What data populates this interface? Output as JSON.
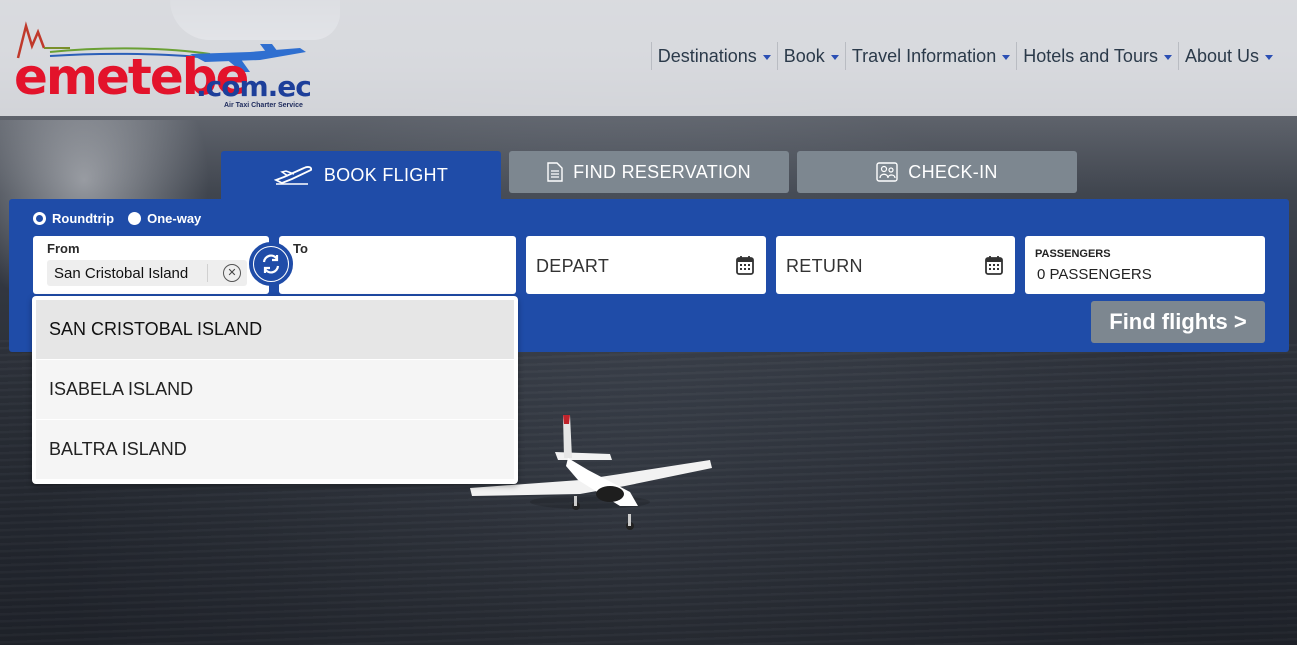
{
  "brand": {
    "logo_text": "emetebe",
    "logo_domain": ".com.ec",
    "logo_tagline": "Air Taxi Charter Service",
    "primary_color": "#1f4ca8",
    "logo_red": "#e3132b"
  },
  "nav": {
    "items": [
      {
        "label": "Destinations"
      },
      {
        "label": "Book"
      },
      {
        "label": "Travel Information"
      },
      {
        "label": "Hotels and Tours"
      },
      {
        "label": "About Us"
      }
    ]
  },
  "tabs": [
    {
      "label": "BOOK FLIGHT",
      "icon": "plane-icon",
      "active": true
    },
    {
      "label": "FIND RESERVATION",
      "icon": "document-icon",
      "active": false
    },
    {
      "label": "CHECK-IN",
      "icon": "passengers-icon",
      "active": false
    }
  ],
  "booking": {
    "trip_types": [
      {
        "label": "Roundtrip",
        "checked": true
      },
      {
        "label": "One-way",
        "checked": false
      }
    ],
    "from": {
      "label": "From",
      "value": "San Cristobal Island"
    },
    "to": {
      "label": "To",
      "value": ""
    },
    "depart": {
      "label": "DEPART"
    },
    "return": {
      "label": "RETURN"
    },
    "passengers": {
      "label": "PASSENGERS",
      "value": "0 PASSENGERS"
    },
    "find_button": "Find flights >"
  },
  "dropdown": {
    "options": [
      {
        "label": "SAN CRISTOBAL ISLAND",
        "highlighted": true
      },
      {
        "label": "ISABELA ISLAND",
        "highlighted": false
      },
      {
        "label": "BALTRA ISLAND",
        "highlighted": false
      }
    ]
  }
}
